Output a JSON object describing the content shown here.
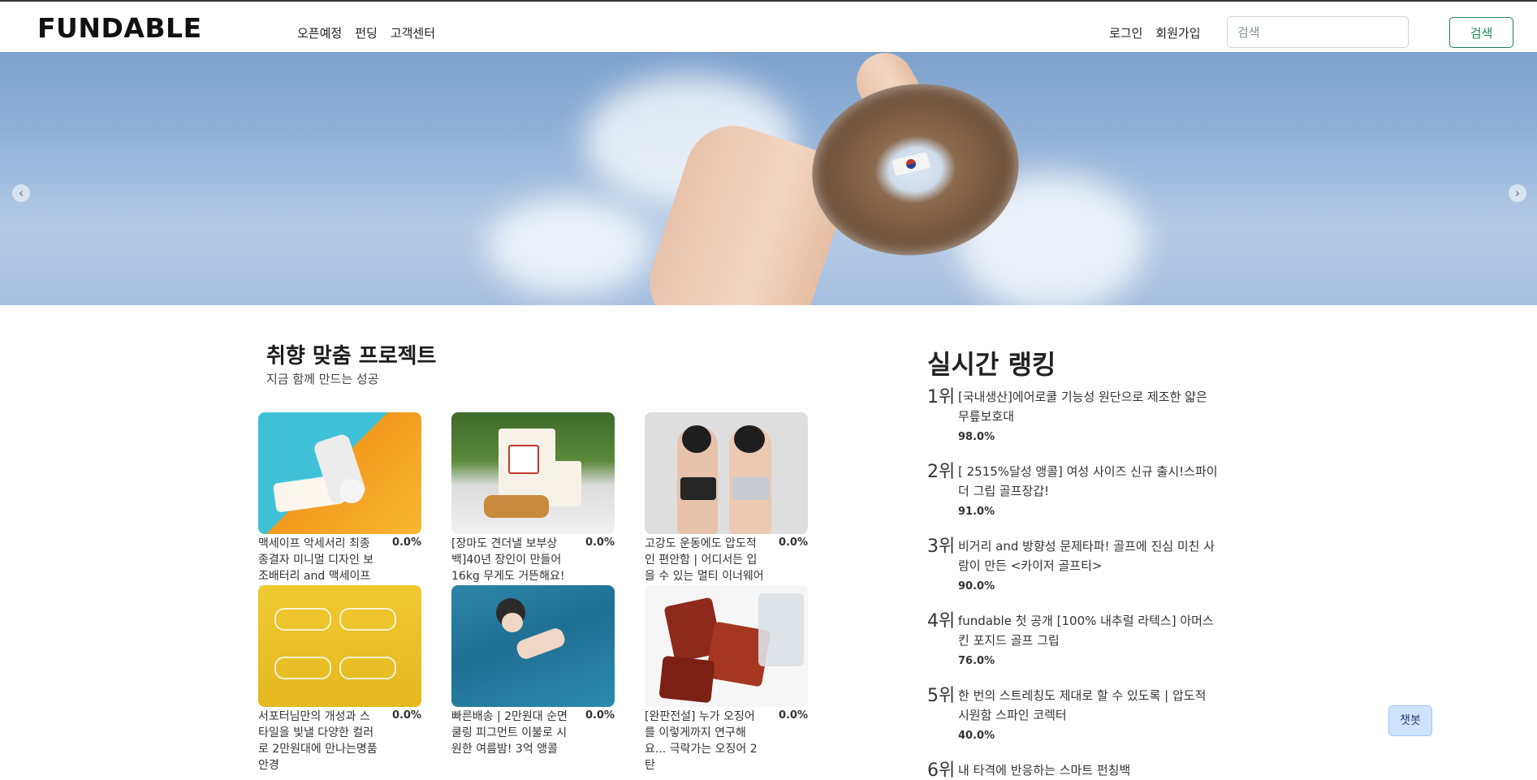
{
  "header": {
    "logo": "FUNDABLE",
    "nav": [
      "오픈예정",
      "펀딩",
      "고객센터"
    ],
    "login": "로그인",
    "signup": "회원가입",
    "search_placeholder": "검색",
    "search_button": "검색"
  },
  "hero": {
    "prev_icon": "‹",
    "next_icon": "›"
  },
  "recommend": {
    "title": "취향 맞춤 프로젝트",
    "subtitle": "지금 함께 만드는 성공",
    "items": [
      {
        "name": "맥세이프 악세서리 최종 종결자 미니멀 디자인 보조배터리 and 맥세이프톡",
        "rate": "0.0%"
      },
      {
        "name": "[장마도 견더낼 보부상 백]40년 장인이 만들어 16kg 무게도 거뜬해요!",
        "rate": "0.0%"
      },
      {
        "name": "고강도 운동에도 압도적인 편안함 | 어디서든 입을 수 있는 멀티 이너웨어",
        "rate": "0.0%"
      },
      {
        "name": "서포터님만의 개성과 스타일을 빛낼 다양한 컬러로 2만원대에 만나는명품안경",
        "rate": "0.0%"
      },
      {
        "name": "빠른배송 | 2만원대 순면 쿨링 피그먼트 이불로 시원한 여름밤! 3억 앵콜",
        "rate": "0.0%"
      },
      {
        "name": "[완판전설] 누가 오징어를 이렇게까지 연구해요... 극락가는 오징어 2탄",
        "rate": "0.0%"
      }
    ]
  },
  "ranking": {
    "title": "실시간 랭킹",
    "items": [
      {
        "rank": "1위",
        "title": "[국내생산]에어로쿨 기능성 원단으로 제조한 얇은 무릎보호대",
        "rate": "98.0%"
      },
      {
        "rank": "2위",
        "title": "[ 2515%달성 앵콜] 여성 사이즈 신규 출시!스파이더 그립 골프장갑!",
        "rate": "91.0%"
      },
      {
        "rank": "3위",
        "title": "비거리 and 방향성 문제타파! 골프에 진심 미친 사람이 만든 <카이저 골프티>",
        "rate": "90.0%"
      },
      {
        "rank": "4위",
        "title": "fundable 첫 공개 [100% 내추럴 라텍스] 아머스킨 포지드 골프 그립",
        "rate": "76.0%"
      },
      {
        "rank": "5위",
        "title": "한 번의 스트레칭도 제대로 할 수 있도록 | 압도적 시원함 스파인 코렉터",
        "rate": "40.0%"
      },
      {
        "rank": "6위",
        "title": "내 타격에 반응하는 스마트 펀칭백",
        "rate": ""
      }
    ]
  },
  "chatbot": "챗봇"
}
